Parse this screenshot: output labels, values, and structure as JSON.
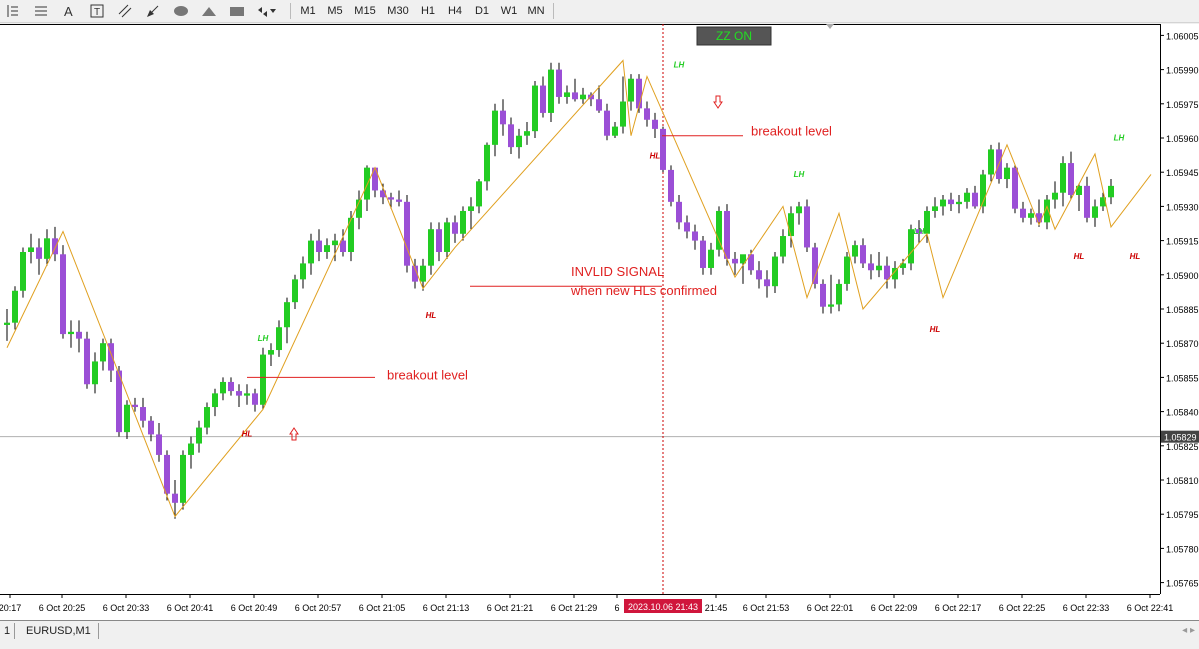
{
  "toolbar": {
    "tools": [
      {
        "name": "vertical-line-icon"
      },
      {
        "name": "horizontal-line-icon"
      },
      {
        "name": "text-icon"
      },
      {
        "name": "text-label-icon"
      },
      {
        "name": "channel-icon"
      },
      {
        "name": "arrow-draw-icon"
      },
      {
        "name": "ellipse-icon"
      },
      {
        "name": "triangle-icon"
      },
      {
        "name": "rectangle-icon"
      },
      {
        "name": "shapes-dropdown-icon"
      }
    ],
    "timeframes": [
      "M1",
      "M5",
      "M15",
      "M30",
      "H1",
      "H4",
      "D1",
      "W1",
      "MN"
    ]
  },
  "zz_toggle": {
    "label": "ZZ ON",
    "color": "#22e022",
    "bg": "#555555"
  },
  "annotations": {
    "breakout_left": "breakout level",
    "breakout_right": "breakout level",
    "invalid_line1": "INVLID SIGNAL",
    "invalid_line2": "when new HLs confirmed"
  },
  "current_price_label": "1.05829",
  "crosshair_time_label": "2023.10.06 21:43",
  "bottom": {
    "tab_number": "1",
    "tab_symbol": "EURUSD,M1"
  },
  "colors": {
    "bull": "#22cc22",
    "bear": "#9b4fd6",
    "zigzag": "#e0a020",
    "annotation": "#e02020",
    "lh": "#22cc22",
    "hl": "#cc0000"
  },
  "chart_data": {
    "type": "candlestick",
    "symbol": "EURUSD",
    "timeframe": "M1",
    "ylim": [
      1.0576,
      1.0601
    ],
    "y_ticks": [
      "1.06005",
      "1.05990",
      "1.05975",
      "1.05960",
      "1.05945",
      "1.05930",
      "1.05915",
      "1.05900",
      "1.05885",
      "1.05870",
      "1.05855",
      "1.05840",
      "1.05825",
      "1.05810",
      "1.05795",
      "1.05780",
      "1.05765"
    ],
    "x_ticks": [
      "20:17",
      "6 Oct 20:25",
      "6 Oct 20:33",
      "6 Oct 20:41",
      "6 Oct 20:49",
      "6 Oct 20:57",
      "6 Oct 21:05",
      "6 Oct 21:13",
      "6 Oct 21:21",
      "6 Oct 21:29",
      "6",
      "21:45",
      "6 Oct 21:53",
      "6 Oct 22:01",
      "6 Oct 22:09",
      "6 Oct 22:17",
      "6 Oct 22:25",
      "6 Oct 22:33",
      "6 Oct 22:41"
    ],
    "candles": [
      [
        1.05878,
        1.05885,
        1.05871,
        1.05879
      ],
      [
        1.05879,
        1.05895,
        1.05876,
        1.05893
      ],
      [
        1.05893,
        1.05912,
        1.0589,
        1.0591
      ],
      [
        1.0591,
        1.05918,
        1.05905,
        1.05912
      ],
      [
        1.05912,
        1.05916,
        1.059,
        1.05907
      ],
      [
        1.05907,
        1.0592,
        1.05904,
        1.05916
      ],
      [
        1.05916,
        1.05921,
        1.05906,
        1.05909
      ],
      [
        1.05909,
        1.05913,
        1.05872,
        1.05874
      ],
      [
        1.05874,
        1.0588,
        1.05868,
        1.05875
      ],
      [
        1.05875,
        1.0588,
        1.05866,
        1.05872
      ],
      [
        1.05872,
        1.05875,
        1.0585,
        1.05852
      ],
      [
        1.05852,
        1.05866,
        1.05848,
        1.05862
      ],
      [
        1.05862,
        1.05872,
        1.05858,
        1.0587
      ],
      [
        1.0587,
        1.05872,
        1.05853,
        1.05858
      ],
      [
        1.05858,
        1.0586,
        1.05829,
        1.05831
      ],
      [
        1.05831,
        1.05845,
        1.05828,
        1.05843
      ],
      [
        1.05843,
        1.05846,
        1.0584,
        1.05842
      ],
      [
        1.05842,
        1.05846,
        1.05833,
        1.05836
      ],
      [
        1.05836,
        1.05838,
        1.05827,
        1.0583
      ],
      [
        1.0583,
        1.05835,
        1.05818,
        1.05821
      ],
      [
        1.05821,
        1.05823,
        1.05801,
        1.05804
      ],
      [
        1.05804,
        1.0581,
        1.05793,
        1.058
      ],
      [
        1.058,
        1.05823,
        1.05797,
        1.05821
      ],
      [
        1.05821,
        1.05829,
        1.05815,
        1.05826
      ],
      [
        1.05826,
        1.05836,
        1.05822,
        1.05833
      ],
      [
        1.05833,
        1.05844,
        1.0583,
        1.05842
      ],
      [
        1.05842,
        1.0585,
        1.05838,
        1.05848
      ],
      [
        1.05848,
        1.05855,
        1.05845,
        1.05853
      ],
      [
        1.05853,
        1.05855,
        1.05847,
        1.05849
      ],
      [
        1.05849,
        1.05852,
        1.05842,
        1.05847
      ],
      [
        1.05847,
        1.05852,
        1.05843,
        1.05848
      ],
      [
        1.05848,
        1.0585,
        1.0584,
        1.05843
      ],
      [
        1.05843,
        1.05868,
        1.05841,
        1.05865
      ],
      [
        1.05865,
        1.0587,
        1.0586,
        1.05867
      ],
      [
        1.05867,
        1.0588,
        1.05864,
        1.05877
      ],
      [
        1.05877,
        1.0589,
        1.0587,
        1.05888
      ],
      [
        1.05888,
        1.059,
        1.05885,
        1.05898
      ],
      [
        1.05898,
        1.05908,
        1.05894,
        1.05905
      ],
      [
        1.05905,
        1.05918,
        1.059,
        1.05915
      ],
      [
        1.05915,
        1.0592,
        1.05906,
        1.0591
      ],
      [
        1.0591,
        1.05916,
        1.05907,
        1.05913
      ],
      [
        1.05913,
        1.05918,
        1.05906,
        1.05915
      ],
      [
        1.05915,
        1.0592,
        1.05908,
        1.0591
      ],
      [
        1.0591,
        1.05928,
        1.05906,
        1.05925
      ],
      [
        1.05925,
        1.05937,
        1.0592,
        1.05933
      ],
      [
        1.05933,
        1.05948,
        1.05928,
        1.05947
      ],
      [
        1.05947,
        1.05946,
        1.05934,
        1.05937
      ],
      [
        1.05937,
        1.0594,
        1.05931,
        1.05934
      ],
      [
        1.05934,
        1.05936,
        1.05929,
        1.05933
      ],
      [
        1.05933,
        1.05937,
        1.0593,
        1.05932
      ],
      [
        1.05932,
        1.05935,
        1.05901,
        1.05904
      ],
      [
        1.05904,
        1.05907,
        1.05894,
        1.05897
      ],
      [
        1.05897,
        1.05907,
        1.05893,
        1.05904
      ],
      [
        1.05904,
        1.05923,
        1.059,
        1.0592
      ],
      [
        1.0592,
        1.05923,
        1.05906,
        1.0591
      ],
      [
        1.0591,
        1.05925,
        1.05907,
        1.05923
      ],
      [
        1.05923,
        1.05926,
        1.05914,
        1.05918
      ],
      [
        1.05918,
        1.0593,
        1.05915,
        1.05928
      ],
      [
        1.05928,
        1.05934,
        1.0592,
        1.0593
      ],
      [
        1.0593,
        1.05942,
        1.05927,
        1.05941
      ],
      [
        1.05941,
        1.05958,
        1.05937,
        1.05957
      ],
      [
        1.05957,
        1.05975,
        1.05952,
        1.05972
      ],
      [
        1.05972,
        1.05977,
        1.05961,
        1.05966
      ],
      [
        1.05966,
        1.05969,
        1.05953,
        1.05956
      ],
      [
        1.05956,
        1.05964,
        1.05951,
        1.05961
      ],
      [
        1.05961,
        1.05967,
        1.05957,
        1.05963
      ],
      [
        1.05963,
        1.05985,
        1.0596,
        1.05983
      ],
      [
        1.05983,
        1.05987,
        1.05969,
        1.05971
      ],
      [
        1.05971,
        1.05993,
        1.05967,
        1.0599
      ],
      [
        1.0599,
        1.05993,
        1.05975,
        1.05978
      ],
      [
        1.05978,
        1.05983,
        1.05975,
        1.0598
      ],
      [
        1.0598,
        1.05986,
        1.05976,
        1.05977
      ],
      [
        1.05977,
        1.05982,
        1.05975,
        1.05979
      ],
      [
        1.05979,
        1.0598,
        1.05974,
        1.05977
      ],
      [
        1.05977,
        1.05983,
        1.05971,
        1.05972
      ],
      [
        1.05972,
        1.05975,
        1.05959,
        1.05961
      ],
      [
        1.05961,
        1.05967,
        1.0596,
        1.05965
      ],
      [
        1.05965,
        1.05987,
        1.05962,
        1.05976
      ],
      [
        1.05976,
        1.05988,
        1.05972,
        1.05986
      ],
      [
        1.05986,
        1.05988,
        1.05971,
        1.05973
      ],
      [
        1.05973,
        1.05976,
        1.05965,
        1.05968
      ],
      [
        1.05968,
        1.05971,
        1.0596,
        1.05964
      ],
      [
        1.05964,
        1.05965,
        1.05945,
        1.05946
      ],
      [
        1.05946,
        1.05948,
        1.0593,
        1.05932
      ],
      [
        1.05932,
        1.05935,
        1.0592,
        1.05923
      ],
      [
        1.05923,
        1.05926,
        1.05916,
        1.05919
      ],
      [
        1.05919,
        1.05922,
        1.05911,
        1.05915
      ],
      [
        1.05915,
        1.05917,
        1.059,
        1.05903
      ],
      [
        1.05903,
        1.05914,
        1.059,
        1.05911
      ],
      [
        1.05911,
        1.0593,
        1.05908,
        1.05928
      ],
      [
        1.05928,
        1.05931,
        1.05904,
        1.05907
      ],
      [
        1.05907,
        1.0591,
        1.059,
        1.05905
      ],
      [
        1.05905,
        1.05908,
        1.05896,
        1.05909
      ],
      [
        1.05909,
        1.05911,
        1.059,
        1.05902
      ],
      [
        1.05902,
        1.05906,
        1.05894,
        1.05898
      ],
      [
        1.05898,
        1.05902,
        1.0589,
        1.05895
      ],
      [
        1.05895,
        1.0591,
        1.05892,
        1.05908
      ],
      [
        1.05908,
        1.0592,
        1.05905,
        1.05917
      ],
      [
        1.05917,
        1.0593,
        1.05912,
        1.05927
      ],
      [
        1.05927,
        1.05932,
        1.05922,
        1.0593
      ],
      [
        1.0593,
        1.05933,
        1.0591,
        1.05912
      ],
      [
        1.05912,
        1.05914,
        1.05894,
        1.05896
      ],
      [
        1.05896,
        1.05898,
        1.05883,
        1.05886
      ],
      [
        1.05886,
        1.059,
        1.05883,
        1.05887
      ],
      [
        1.05887,
        1.05898,
        1.05884,
        1.05896
      ],
      [
        1.05896,
        1.0591,
        1.05893,
        1.05908
      ],
      [
        1.05908,
        1.05915,
        1.05905,
        1.05913
      ],
      [
        1.05913,
        1.05916,
        1.05903,
        1.05905
      ],
      [
        1.05905,
        1.05909,
        1.05898,
        1.05902
      ],
      [
        1.05902,
        1.0591,
        1.05899,
        1.05904
      ],
      [
        1.05904,
        1.05908,
        1.05894,
        1.05898
      ],
      [
        1.05898,
        1.05906,
        1.05894,
        1.05903
      ],
      [
        1.05903,
        1.05907,
        1.059,
        1.05905
      ],
      [
        1.05905,
        1.05922,
        1.05902,
        1.0592
      ],
      [
        1.0592,
        1.05924,
        1.05914,
        1.05918
      ],
      [
        1.05918,
        1.0593,
        1.05914,
        1.05928
      ],
      [
        1.05928,
        1.05934,
        1.05925,
        1.0593
      ],
      [
        1.0593,
        1.05935,
        1.05926,
        1.05933
      ],
      [
        1.05933,
        1.05936,
        1.05928,
        1.05931
      ],
      [
        1.05931,
        1.05935,
        1.05927,
        1.05932
      ],
      [
        1.05932,
        1.05938,
        1.05929,
        1.05936
      ],
      [
        1.05936,
        1.05939,
        1.05929,
        1.0593
      ],
      [
        1.0593,
        1.05946,
        1.05927,
        1.05944
      ],
      [
        1.05944,
        1.05957,
        1.05941,
        1.05955
      ],
      [
        1.05955,
        1.05958,
        1.0594,
        1.05942
      ],
      [
        1.05942,
        1.05949,
        1.05938,
        1.05947
      ],
      [
        1.05947,
        1.05948,
        1.05927,
        1.05929
      ],
      [
        1.05929,
        1.05932,
        1.05923,
        1.05925
      ],
      [
        1.05925,
        1.05929,
        1.05922,
        1.05927
      ],
      [
        1.05927,
        1.05933,
        1.05921,
        1.05923
      ],
      [
        1.05923,
        1.05935,
        1.0592,
        1.05933
      ],
      [
        1.05933,
        1.05941,
        1.05929,
        1.05936
      ],
      [
        1.05936,
        1.05952,
        1.0593,
        1.05949
      ],
      [
        1.05949,
        1.05954,
        1.05933,
        1.05935
      ],
      [
        1.05935,
        1.0594,
        1.05928,
        1.05939
      ],
      [
        1.05939,
        1.05943,
        1.05923,
        1.05925
      ],
      [
        1.05925,
        1.05933,
        1.05921,
        1.0593
      ],
      [
        1.0593,
        1.05936,
        1.05928,
        1.05934
      ],
      [
        1.05934,
        1.05942,
        1.05931,
        1.05939
      ]
    ],
    "zigzag": [
      [
        0,
        1.05868
      ],
      [
        7,
        1.05919
      ],
      [
        21,
        1.05794
      ],
      [
        32,
        1.05841
      ],
      [
        46,
        1.05947
      ],
      [
        52,
        1.05894
      ],
      [
        56,
        1.05912
      ],
      [
        77,
        1.05994
      ],
      [
        78,
        1.05961
      ],
      [
        80,
        1.05987
      ],
      [
        83,
        1.05963
      ],
      [
        91,
        1.05899
      ],
      [
        97,
        1.0593
      ],
      [
        100,
        1.0589
      ],
      [
        104,
        1.05927
      ],
      [
        107,
        1.05885
      ],
      [
        115,
        1.05918
      ],
      [
        117,
        1.0589
      ],
      [
        125,
        1.05957
      ],
      [
        129,
        1.05922
      ],
      [
        130,
        1.0593
      ],
      [
        131,
        1.0592
      ],
      [
        136,
        1.05953
      ],
      [
        138,
        1.05921
      ],
      [
        143,
        1.05944
      ]
    ],
    "labels": [
      {
        "text": "LH",
        "i": 32,
        "price": 1.05871,
        "color": "green"
      },
      {
        "text": "HL",
        "i": 30,
        "price": 1.05829,
        "color": "red"
      },
      {
        "text": "HL",
        "i": 53,
        "price": 1.05881,
        "color": "red"
      },
      {
        "text": "LH",
        "i": 84,
        "price": 1.05991,
        "color": "green"
      },
      {
        "text": "HL",
        "i": 81,
        "price": 1.05951,
        "color": "red"
      },
      {
        "text": "LH",
        "i": 99,
        "price": 1.05943,
        "color": "green"
      },
      {
        "text": "HL",
        "i": 116,
        "price": 1.05875,
        "color": "red"
      },
      {
        "text": "LH",
        "i": 114,
        "price": 1.05918,
        "color": "green"
      },
      {
        "text": "HL",
        "i": 134,
        "price": 1.05907,
        "color": "red"
      },
      {
        "text": "LH",
        "i": 139,
        "price": 1.05959,
        "color": "green"
      },
      {
        "text": "HL",
        "i": 141,
        "price": 1.05907,
        "color": "red"
      }
    ]
  }
}
